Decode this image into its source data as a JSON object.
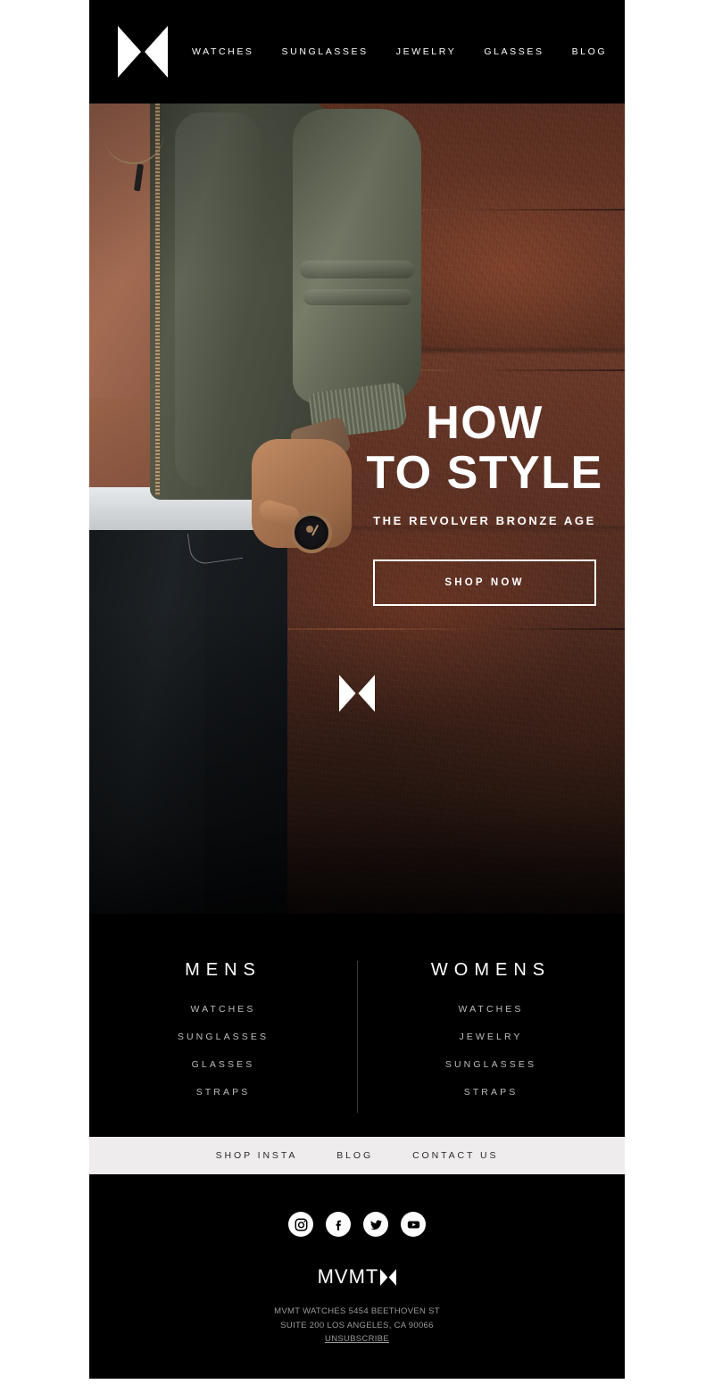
{
  "header": {
    "logo": "mvmt-bowtie-logo",
    "nav": [
      {
        "label": "WATCHES"
      },
      {
        "label": "SUNGLASSES"
      },
      {
        "label": "JEWELRY"
      },
      {
        "label": "GLASSES"
      },
      {
        "label": "BLOG"
      }
    ]
  },
  "hero": {
    "title_line1": "HOW",
    "title_line2": "TO STYLE",
    "subtitle": "THE REVOLVER BRONZE AGE",
    "cta_label": "SHOP NOW",
    "logo": "mvmt-bowtie-logo",
    "image_description": "Man in olive bomber jacket and black jeans wearing a bronze watch, standing against a rusted metal wall"
  },
  "categories": [
    {
      "heading": "MENS",
      "links": [
        {
          "label": "WATCHES"
        },
        {
          "label": "SUNGLASSES"
        },
        {
          "label": "GLASSES"
        },
        {
          "label": "STRAPS"
        }
      ]
    },
    {
      "heading": "WOMENS",
      "links": [
        {
          "label": "WATCHES"
        },
        {
          "label": "JEWELRY"
        },
        {
          "label": "SUNGLASSES"
        },
        {
          "label": "STRAPS"
        }
      ]
    }
  ],
  "graybar": [
    {
      "label": "SHOP INSTA"
    },
    {
      "label": "BLOG"
    },
    {
      "label": "CONTACT US"
    }
  ],
  "footer": {
    "socials": [
      {
        "name": "instagram-icon"
      },
      {
        "name": "facebook-icon"
      },
      {
        "name": "twitter-icon"
      },
      {
        "name": "youtube-icon"
      }
    ],
    "wordmark": "MVMT",
    "address_line1": "MVMT WATCHES 5454 BEETHOVEN ST",
    "address_line2": "SUITE 200 LOS ANGELES, CA 90066",
    "unsubscribe": "UNSUBSCRIBE"
  },
  "colors": {
    "black": "#000000",
    "white": "#ffffff",
    "graybar_bg": "#eeecec",
    "muted_text": "#bdbdbd",
    "rust": "#6d3a29"
  }
}
